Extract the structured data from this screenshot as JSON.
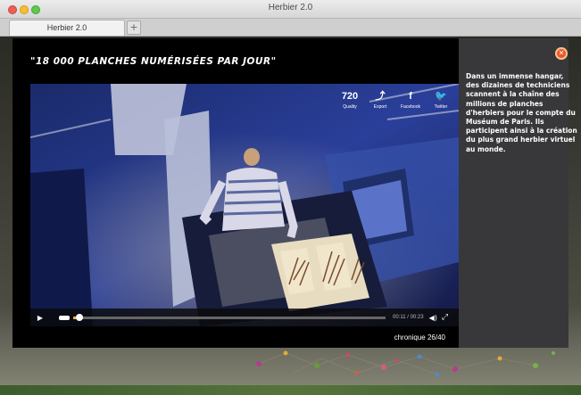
{
  "window": {
    "title": "Herbier 2.0"
  },
  "tabs": [
    {
      "label": "Herbier 2.0"
    }
  ],
  "new_tab_label": "+",
  "modal": {
    "headline": "\"18 000 PLANCHES NUMÉRISÉES PAR JOUR\"",
    "share": [
      {
        "icon": "720",
        "label": "Quality",
        "icon_name": "quality-icon"
      },
      {
        "icon": "⤴",
        "label": "Export",
        "icon_name": "export-icon"
      },
      {
        "icon": "f",
        "label": "Facebook",
        "icon_name": "facebook-icon"
      },
      {
        "icon": "🐦",
        "label": "Twitter",
        "icon_name": "twitter-icon"
      }
    ],
    "player": {
      "time": "00:11 / 00:23",
      "progress": 0.02
    },
    "chronique": "chronique 26/40",
    "caption": "Dans un immense hangar, des dizaines de techniciens scannent à la chaîne des millions de planches d'herbiers pour le compte du Muséum de Paris. Ils participent ainsi à la création du plus grand herbier virtuel au monde."
  },
  "colors": {
    "accent": "#f2b23c",
    "close_button": "#e8562a",
    "side_panel": "#38383a"
  }
}
